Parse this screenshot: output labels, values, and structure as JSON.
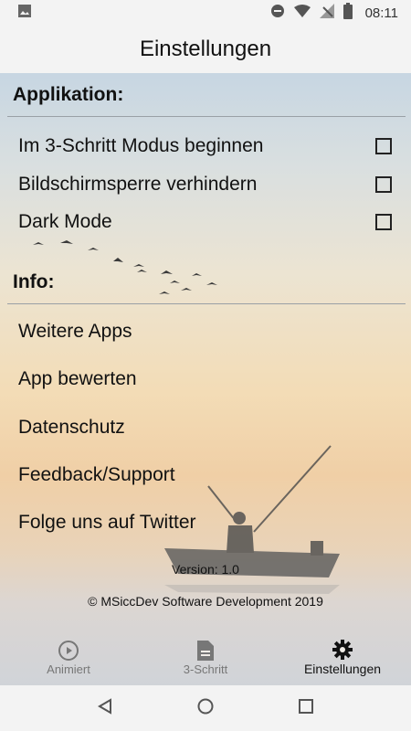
{
  "status_bar": {
    "time": "08:11",
    "icons": [
      "image-icon",
      "do-not-disturb-icon",
      "wifi-icon",
      "no-signal-icon",
      "battery-icon"
    ]
  },
  "header": {
    "title": "Einstellungen"
  },
  "sections": {
    "applikation": {
      "title": "Applikation:",
      "options": [
        {
          "label": "Im 3-Schritt Modus beginnen",
          "checked": false
        },
        {
          "label": "Bildschirmsperre verhindern",
          "checked": false
        },
        {
          "label": "Dark Mode",
          "checked": false
        }
      ]
    },
    "info": {
      "title": "Info:",
      "links": [
        "Weitere Apps",
        "App bewerten",
        "Datenschutz",
        "Feedback/Support",
        "Folge uns auf Twitter"
      ]
    }
  },
  "footer": {
    "version": "Version: 1.0",
    "copyright": "© MSiccDev Software Development 2019"
  },
  "tabs": [
    {
      "label": "Animiert",
      "icon": "play-circle-icon",
      "active": false
    },
    {
      "label": "3-Schritt",
      "icon": "document-icon",
      "active": false
    },
    {
      "label": "Einstellungen",
      "icon": "gear-icon",
      "active": true
    }
  ],
  "nav": {
    "icons": [
      "back-icon",
      "home-icon",
      "recents-icon"
    ]
  }
}
